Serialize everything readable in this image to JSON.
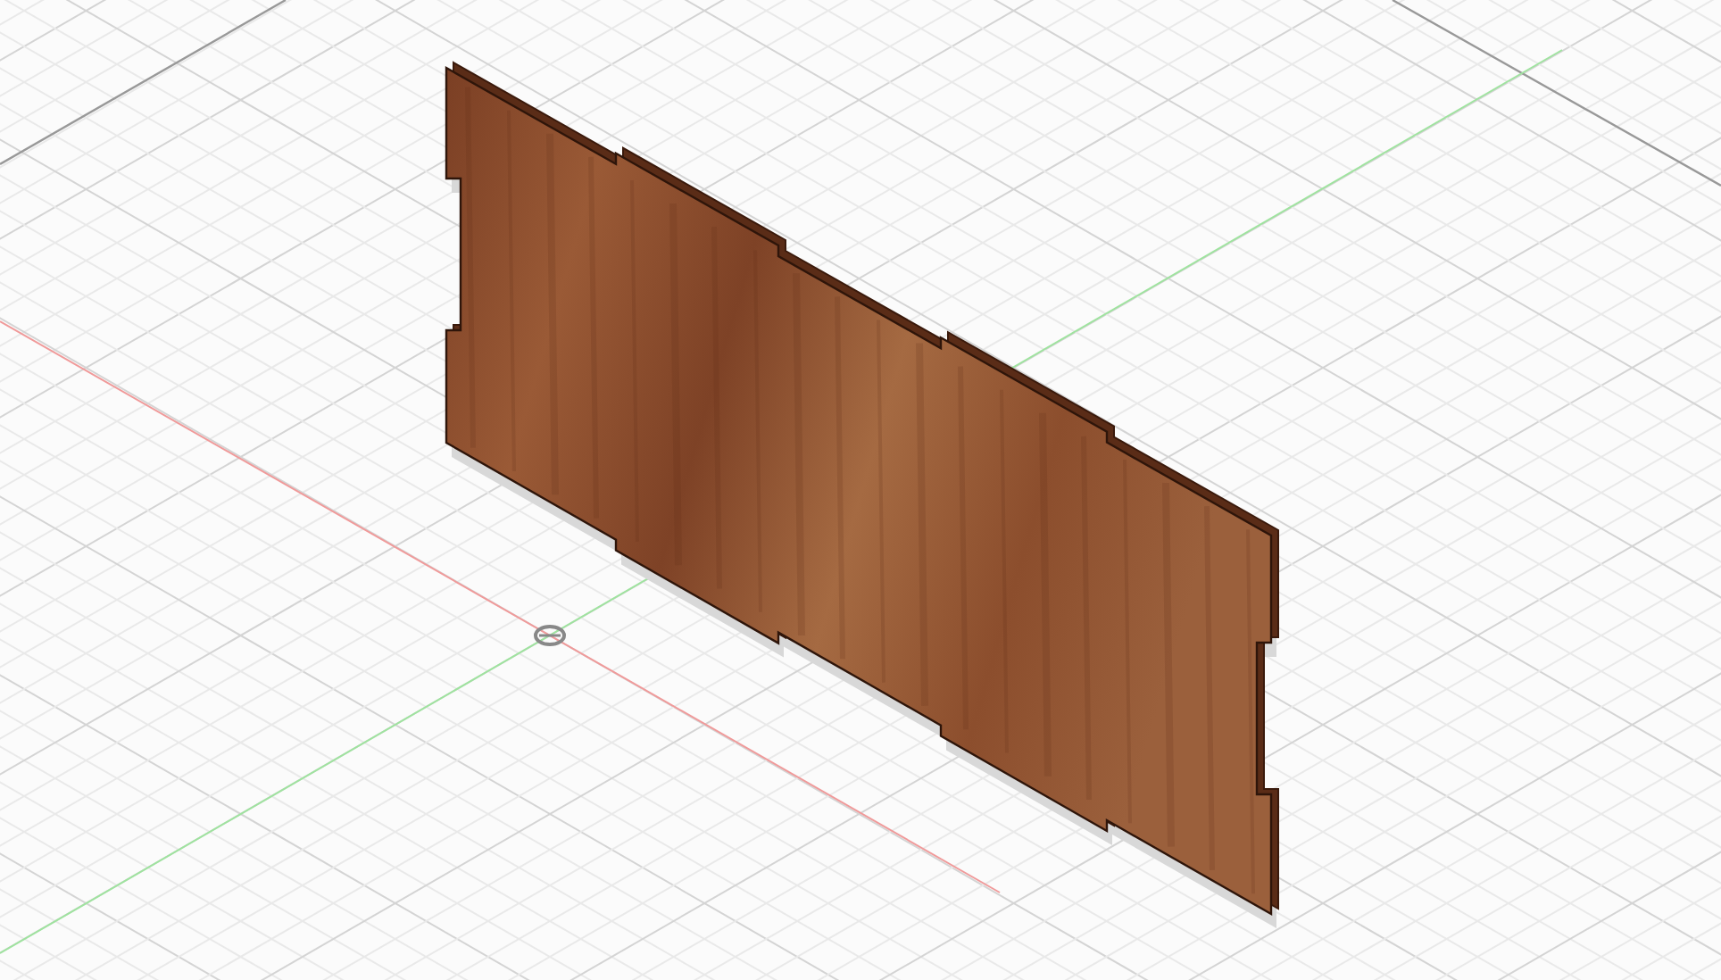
{
  "viewport": {
    "grid": true,
    "axes": true,
    "origin_marker": true
  }
}
